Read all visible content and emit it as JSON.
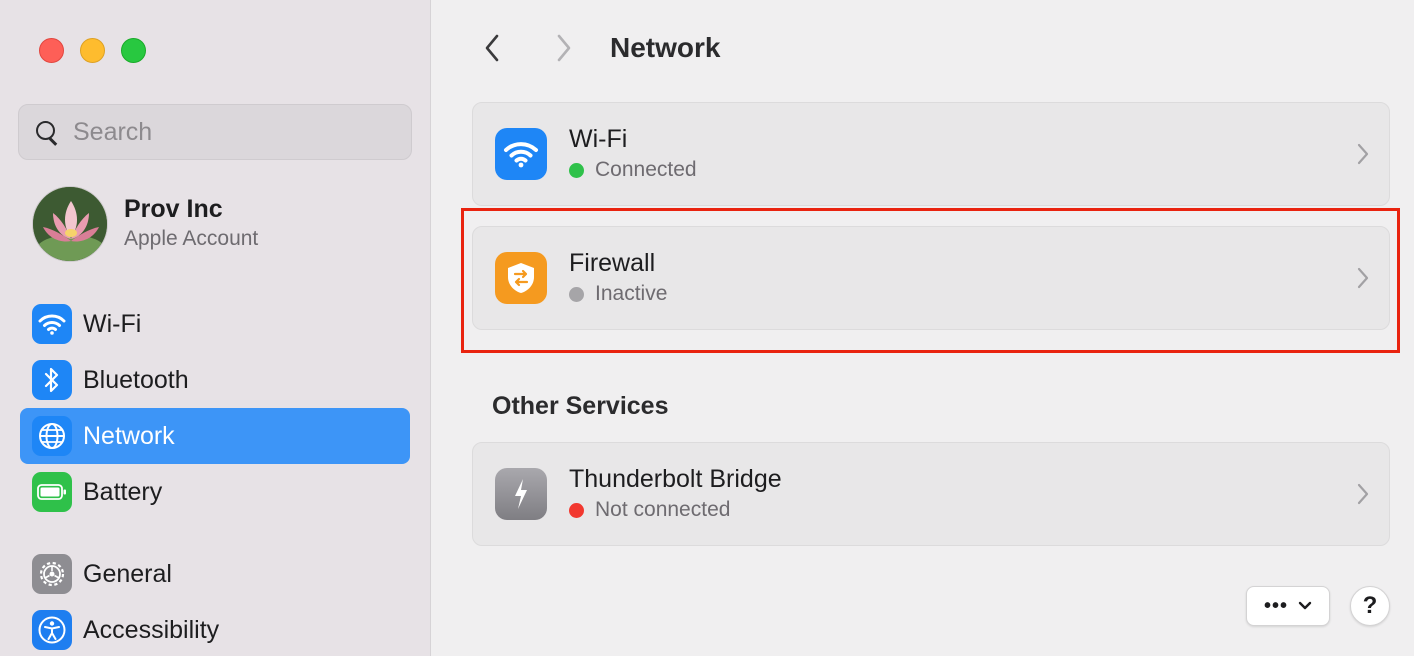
{
  "window": {
    "title": "Network"
  },
  "sidebar": {
    "search": {
      "placeholder": "Search",
      "value": ""
    },
    "account": {
      "name": "Prov Inc",
      "subtitle": "Apple Account"
    },
    "items": [
      {
        "label": "Wi-Fi",
        "icon": "wifi-icon",
        "selected": false
      },
      {
        "label": "Bluetooth",
        "icon": "bluetooth-icon",
        "selected": false
      },
      {
        "label": "Network",
        "icon": "globe-icon",
        "selected": true
      },
      {
        "label": "Battery",
        "icon": "battery-icon",
        "selected": false
      },
      {
        "label": "General",
        "icon": "gear-icon",
        "selected": false
      },
      {
        "label": "Accessibility",
        "icon": "accessibility-icon",
        "selected": false
      }
    ]
  },
  "main": {
    "services": [
      {
        "label": "Wi-Fi",
        "status": "Connected",
        "status_color": "#2fc14a",
        "icon": "wifi-icon",
        "icon_color": "#1e86f6"
      },
      {
        "label": "Firewall",
        "status": "Inactive",
        "status_color": "#a6a5a8",
        "icon": "firewall-shield-icon",
        "icon_color": "#f59a1f"
      }
    ],
    "other_section_title": "Other Services",
    "other_services": [
      {
        "label": "Thunderbolt Bridge",
        "status": "Not connected",
        "status_color": "#f2382f",
        "icon": "thunderbolt-icon",
        "icon_color": "#8e8d92"
      }
    ],
    "more_button": "•••",
    "help_button": "?"
  },
  "colors": {
    "accent": "#3d95f7",
    "highlight_box": "#e9230f",
    "sidebar_bg": "#e7e2e6",
    "content_bg": "#f0eff0"
  }
}
